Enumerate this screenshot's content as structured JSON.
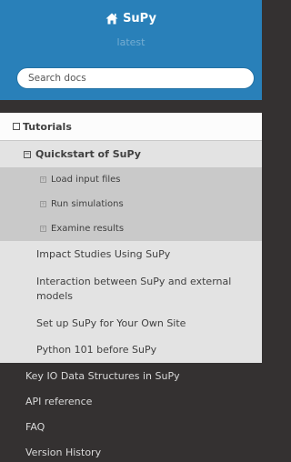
{
  "brand": {
    "title": "SuPy",
    "version": "latest",
    "home_icon": "home-icon"
  },
  "search": {
    "placeholder": "Search docs",
    "value": ""
  },
  "nav": {
    "tutorials": {
      "label": "Tutorials",
      "toggle_symbol": "",
      "quickstart": {
        "label": "Quickstart of SuPy",
        "toggle_symbol": "−",
        "children": [
          {
            "label": "Load input files",
            "toggle_symbol": "+"
          },
          {
            "label": "Run simulations",
            "toggle_symbol": "+"
          },
          {
            "label": "Examine results",
            "toggle_symbol": "+"
          }
        ]
      },
      "siblings": [
        {
          "label": "Impact Studies Using SuPy"
        },
        {
          "label": "Interaction between SuPy and external models"
        },
        {
          "label": "Set up SuPy for Your Own Site"
        },
        {
          "label": "Python 101 before SuPy"
        }
      ]
    },
    "root_items": [
      {
        "label": "Key IO Data Structures in SuPy"
      },
      {
        "label": "API reference"
      },
      {
        "label": "FAQ"
      },
      {
        "label": "Version History"
      }
    ]
  },
  "colors": {
    "header_blue": "#2980b9",
    "sidebar_dark": "#343131",
    "current_l1": "#fcfcfc",
    "current_l2": "#e3e3e3",
    "current_l3": "#c9c9c9"
  }
}
